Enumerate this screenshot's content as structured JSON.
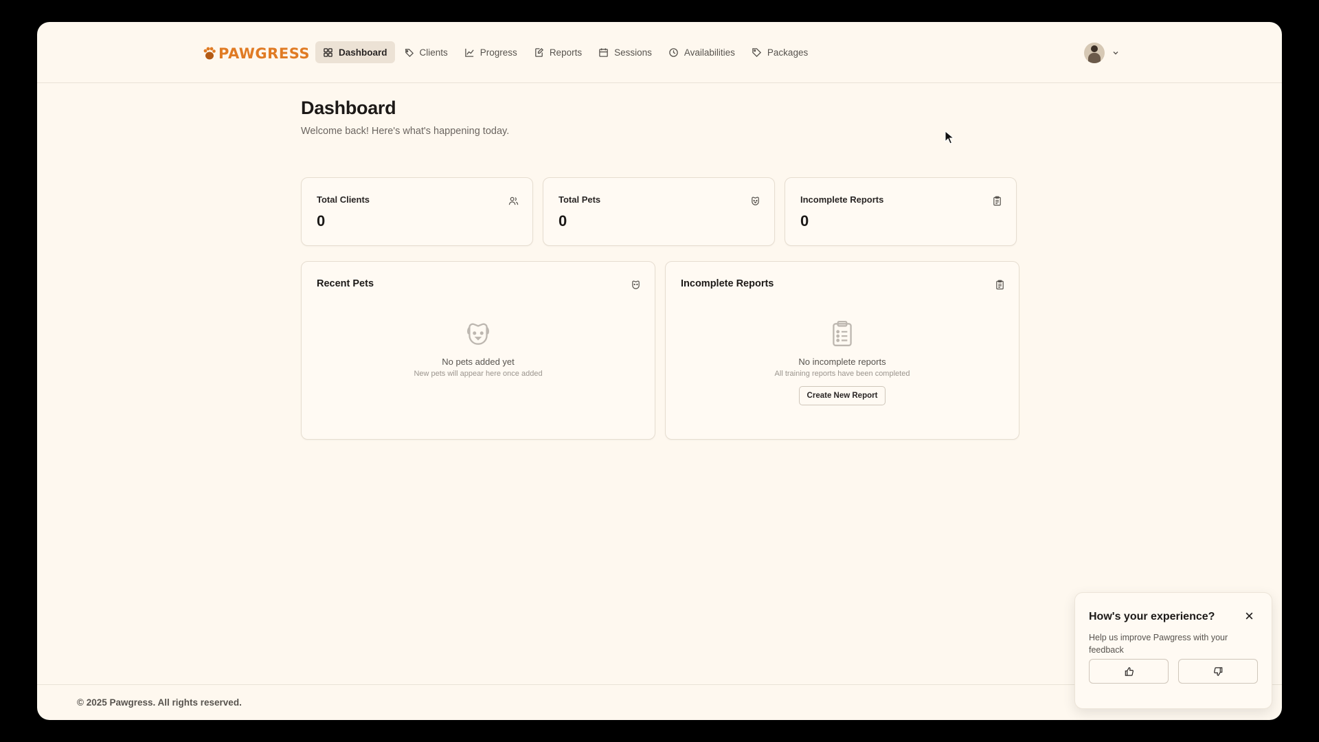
{
  "brand": {
    "name": "PAWGRESS",
    "color": "#e07b24"
  },
  "nav": [
    {
      "label": "Dashboard",
      "icon": "grid-icon",
      "active": true
    },
    {
      "label": "Clients",
      "icon": "tag-heart-icon"
    },
    {
      "label": "Progress",
      "icon": "line-chart-icon"
    },
    {
      "label": "Reports",
      "icon": "edit-document-icon"
    },
    {
      "label": "Sessions",
      "icon": "calendar-icon"
    },
    {
      "label": "Availabilities",
      "icon": "clock-icon"
    },
    {
      "label": "Packages",
      "icon": "tag-icon"
    }
  ],
  "page": {
    "title": "Dashboard",
    "subtitle": "Welcome back! Here's what's happening today."
  },
  "stats": [
    {
      "label": "Total Clients",
      "value": "0",
      "icon": "users-icon"
    },
    {
      "label": "Total Pets",
      "value": "0",
      "icon": "dog-icon"
    },
    {
      "label": "Incomplete Reports",
      "value": "0",
      "icon": "clipboard-icon"
    }
  ],
  "recent_pets": {
    "title": "Recent Pets",
    "empty_title": "No pets added yet",
    "empty_sub": "New pets will appear here once added"
  },
  "incomplete_reports": {
    "title": "Incomplete Reports",
    "empty_title": "No incomplete reports",
    "empty_sub": "All training reports have been completed",
    "button": "Create New Report"
  },
  "footer": {
    "copyright": "© 2025 Pawgress. All rights reserved."
  },
  "feedback": {
    "title": "How's your experience?",
    "text": "Help us improve Pawgress with your feedback"
  }
}
